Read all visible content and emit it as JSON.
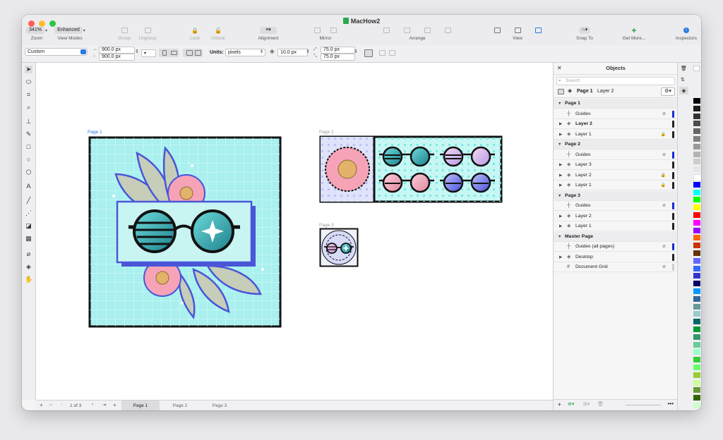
{
  "window": {
    "title": "MacHow2"
  },
  "toolbar": {
    "zoom": {
      "value": "341%",
      "label": "Zoom"
    },
    "view_modes": {
      "value": "Enhanced",
      "label": "View Modes"
    },
    "group": "Group",
    "ungroup": "Ungroup",
    "lock": "Lock",
    "unlock": "Unlock",
    "alignment": "Alignment",
    "mirror": "Mirror",
    "arrange": "Arrange",
    "view": "View",
    "snap_to": "Snap To",
    "get_more": "Get More...",
    "inspectors": "Inspectors"
  },
  "props": {
    "preset": "Custom",
    "width": "900.0 px",
    "height": "900.0 px",
    "units_label": "Units:",
    "units": "pixels",
    "nudge": "10.0 px",
    "dup_x": "75.0 px",
    "dup_y": "75.0 px"
  },
  "canvas": {
    "page1_label": "Page 1",
    "page2_label": "Page 2",
    "page3_label": "Page 3"
  },
  "status": {
    "page_indicator": "1 of 3",
    "tabs": [
      "Page 1",
      "Page 2",
      "Page 3"
    ]
  },
  "objects": {
    "title": "Objects",
    "search_placeholder": "Search",
    "current_page": "Page 1",
    "current_layer": "Layer 2",
    "rows": [
      {
        "label": "Page 1",
        "type": "group"
      },
      {
        "label": "Guides",
        "type": "guides",
        "color": "#1a2bd6"
      },
      {
        "label": "Layer 2",
        "type": "layer",
        "bold": true,
        "color": "#222222"
      },
      {
        "label": "Layer 1",
        "type": "layer",
        "locked": true,
        "color": "#222222"
      },
      {
        "label": "Page 2",
        "type": "group"
      },
      {
        "label": "Guides",
        "type": "guides",
        "color": "#1a2bd6"
      },
      {
        "label": "Layer 3",
        "type": "layer",
        "color": "#222222"
      },
      {
        "label": "Layer 2",
        "type": "layer",
        "locked": true,
        "color": "#222222"
      },
      {
        "label": "Layer 1",
        "type": "layer",
        "locked": true,
        "color": "#222222"
      },
      {
        "label": "Page 3",
        "type": "group"
      },
      {
        "label": "Guides",
        "type": "guides",
        "color": "#1a2bd6"
      },
      {
        "label": "Layer 2",
        "type": "layer",
        "color": "#222222"
      },
      {
        "label": "Layer 1",
        "type": "layer",
        "color": "#222222"
      },
      {
        "label": "Master Page",
        "type": "group"
      },
      {
        "label": "Guides (all pages)",
        "type": "guides",
        "color": "#1a2bd6"
      },
      {
        "label": "Desktop",
        "type": "layer",
        "color": "#222222"
      },
      {
        "label": "Document Grid",
        "type": "grid",
        "color": "#cccccc"
      }
    ]
  },
  "palette": {
    "colors": [
      "#000000",
      "#1c1c1c",
      "#333333",
      "#4d4d4d",
      "#666666",
      "#808080",
      "#999999",
      "#b3b3b3",
      "#cccccc",
      "#e6e6e6",
      "#ffffff",
      "#0000ff",
      "#00ffff",
      "#00ff00",
      "#ffff00",
      "#ff0000",
      "#ff00ff",
      "#9900ff",
      "#ff6600",
      "#cc3300",
      "#663300",
      "#6666ff",
      "#3366ff",
      "#3333cc",
      "#000066",
      "#0099ff",
      "#336699",
      "#669999",
      "#99cccc",
      "#006666",
      "#009933",
      "#339966",
      "#66cc99",
      "#99ffcc",
      "#33cc33",
      "#66ff66",
      "#99cc33",
      "#ccff99",
      "#669933",
      "#336600",
      "#ccffcc"
    ]
  }
}
